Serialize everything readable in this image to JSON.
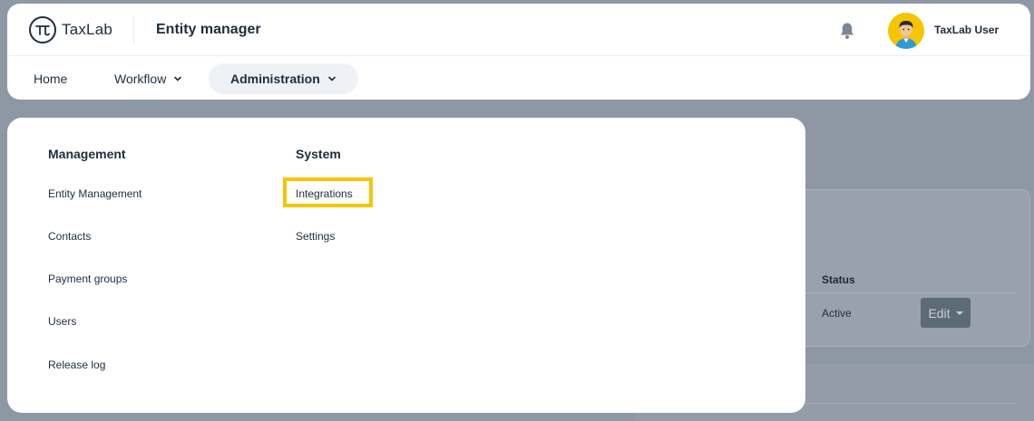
{
  "app": {
    "logo_text": "TaxLab",
    "page_title": "Entity manager",
    "user_name": "TaxLab User"
  },
  "nav": {
    "home": "Home",
    "workflow": "Workflow",
    "administration": "Administration"
  },
  "menu": {
    "management": {
      "heading": "Management",
      "items": [
        "Entity Management",
        "Contacts",
        "Payment groups",
        "Users",
        "Release log"
      ]
    },
    "system": {
      "heading": "System",
      "items": [
        "Integrations",
        "Settings"
      ]
    }
  },
  "background_table": {
    "status_header": "Status",
    "status_value": "Active",
    "edit_label": "Edit"
  },
  "colors": {
    "overlay": "#8e98a5",
    "highlight": "#f8c400",
    "avatar_bg": "#f7c400",
    "active_nav_bg": "#eef1f5"
  },
  "icons": {
    "logo": "pi-logo-icon",
    "notifications": "bell-icon",
    "dropdown": "chevron-down-icon"
  }
}
